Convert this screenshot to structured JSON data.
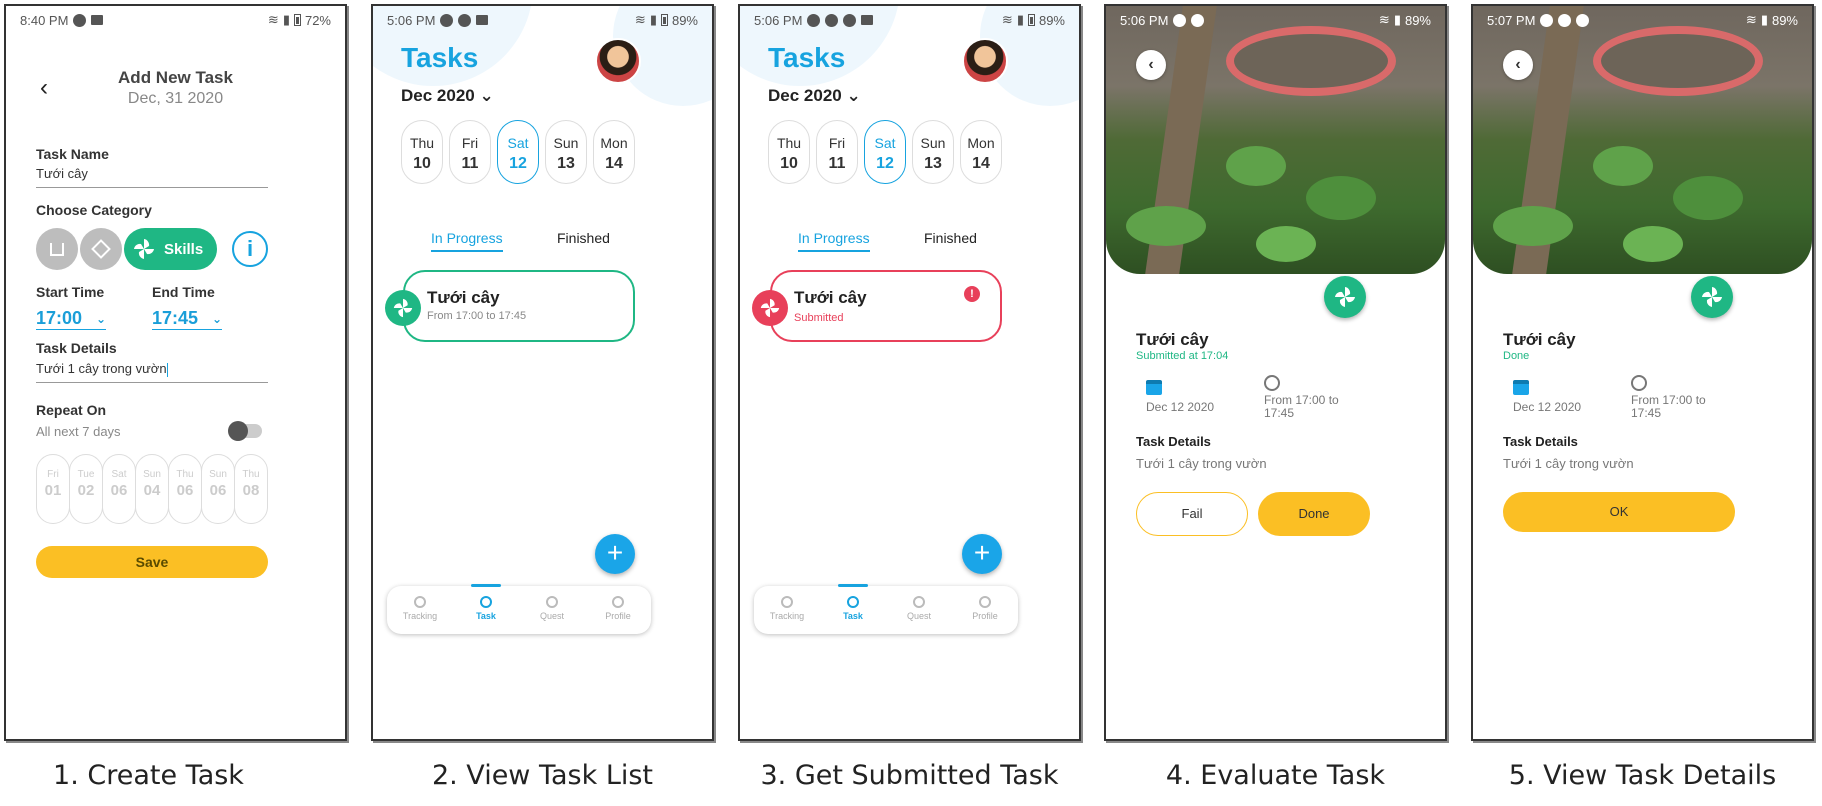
{
  "screens": [
    {
      "caption": "1. Create Task",
      "status": {
        "time": "8:40 PM",
        "battery": "72%"
      },
      "header": {
        "title": "Add New Task",
        "date": "Dec, 31 2020"
      },
      "task_name": {
        "label": "Task Name",
        "value": "Tưới cây"
      },
      "category": {
        "label": "Choose Category",
        "selected": "Skills"
      },
      "start": {
        "label": "Start Time",
        "value": "17:00"
      },
      "end": {
        "label": "End Time",
        "value": "17:45"
      },
      "details": {
        "label": "Task Details",
        "value": "Tưới 1 cây trong vườn"
      },
      "repeat": {
        "label": "Repeat On",
        "sub": "All next 7 days",
        "days": [
          {
            "n": "Fri",
            "d": "01"
          },
          {
            "n": "Tue",
            "d": "02"
          },
          {
            "n": "Sat",
            "d": "06"
          },
          {
            "n": "Sun",
            "d": "04"
          },
          {
            "n": "Thu",
            "d": "06"
          },
          {
            "n": "Sun",
            "d": "06"
          },
          {
            "n": "Thu",
            "d": "08"
          }
        ]
      },
      "save": "Save"
    },
    {
      "caption": "2. View Task List",
      "status": {
        "time": "5:06 PM",
        "battery": "89%"
      }
    },
    {
      "caption": "3. Get Submitted Task",
      "status": {
        "time": "5:06 PM",
        "battery": "89%"
      }
    },
    {
      "caption": "4. Evaluate Task",
      "status": {
        "time": "5:06 PM",
        "battery": "89%"
      }
    },
    {
      "caption": "5. View Task Details",
      "status": {
        "time": "5:07 PM",
        "battery": "89%"
      }
    }
  ],
  "tasks_page": {
    "title": "Tasks",
    "month": "Dec 2020",
    "days": [
      {
        "n": "Thu",
        "d": "10"
      },
      {
        "n": "Fri",
        "d": "11"
      },
      {
        "n": "Sat",
        "d": "12"
      },
      {
        "n": "Sun",
        "d": "13"
      },
      {
        "n": "Mon",
        "d": "14"
      }
    ],
    "tabs": [
      "In Progress",
      "Finished"
    ],
    "task_name": "Tưới cây",
    "task_time": "From 17:00 to 17:45",
    "submitted": "Submitted",
    "nav": [
      "Tracking",
      "Task",
      "Quest",
      "Profile"
    ],
    "fab": "+"
  },
  "detail_page": {
    "task_name": "Tưới cây",
    "submitted_at": "Submitted at 17:04",
    "done_status": "Done",
    "date": "Dec 12 2020",
    "time_range": "From 17:00 to 17:45",
    "details_label": "Task Details",
    "details": "Tưới 1 cây trong vườn",
    "fail": "Fail",
    "done": "Done",
    "ok": "OK"
  },
  "colors": {
    "primary": "#17a3df",
    "green": "#1fb784",
    "red": "#e8405a",
    "yellow": "#fbbf24"
  }
}
